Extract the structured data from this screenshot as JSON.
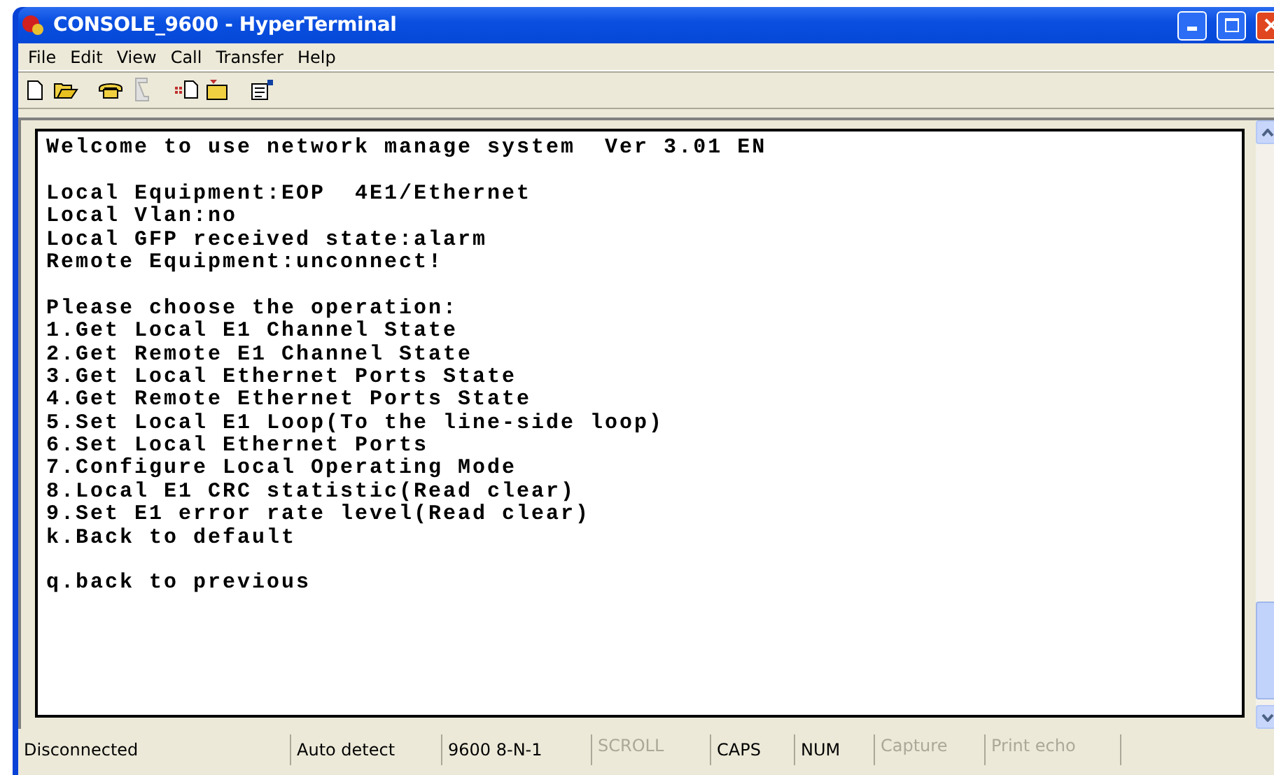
{
  "window": {
    "title": "CONSOLE_9600 - HyperTerminal"
  },
  "menu": [
    "File",
    "Edit",
    "View",
    "Call",
    "Transfer",
    "Help"
  ],
  "toolbar": [
    {
      "kind": "new",
      "disabled": false
    },
    {
      "kind": "open",
      "disabled": false
    },
    {
      "kind": "call",
      "disabled": false
    },
    {
      "kind": "hangup",
      "disabled": true
    },
    {
      "kind": "send",
      "disabled": false
    },
    {
      "kind": "receive",
      "disabled": false
    },
    {
      "kind": "properties",
      "disabled": false
    }
  ],
  "terminal": {
    "blocks": [
      [
        "Welcome to use network manage system  Ver 3.01 EN"
      ],
      [
        "Local Equipment:EOP  4E1/Ethernet",
        "Local Vlan:no",
        "Local GFP received state:alarm",
        "Remote Equipment:unconnect!"
      ],
      [
        "Please choose the operation:",
        "1.Get Local E1 Channel State",
        "2.Get Remote E1 Channel State",
        "3.Get Local Ethernet Ports State",
        "4.Get Remote Ethernet Ports State",
        "5.Set Local E1 Loop(To the line-side loop)",
        "6.Set Local Ethernet Ports",
        "7.Configure Local Operating Mode",
        "8.Local E1 CRC statistic(Read clear)",
        "9.Set E1 error rate level(Read clear)",
        "k.Back to default"
      ],
      [
        "q.back to previous"
      ]
    ]
  },
  "status_bar": [
    {
      "text": "Disconnected",
      "disabled": false
    },
    {
      "text": "Auto detect",
      "disabled": false
    },
    {
      "text": "9600 8-N-1",
      "disabled": false
    },
    {
      "text": "SCROLL",
      "disabled": true
    },
    {
      "text": "CAPS",
      "disabled": false
    },
    {
      "text": "NUM",
      "disabled": false
    },
    {
      "text": "Capture",
      "disabled": true
    },
    {
      "text": "Print echo",
      "disabled": true
    }
  ]
}
